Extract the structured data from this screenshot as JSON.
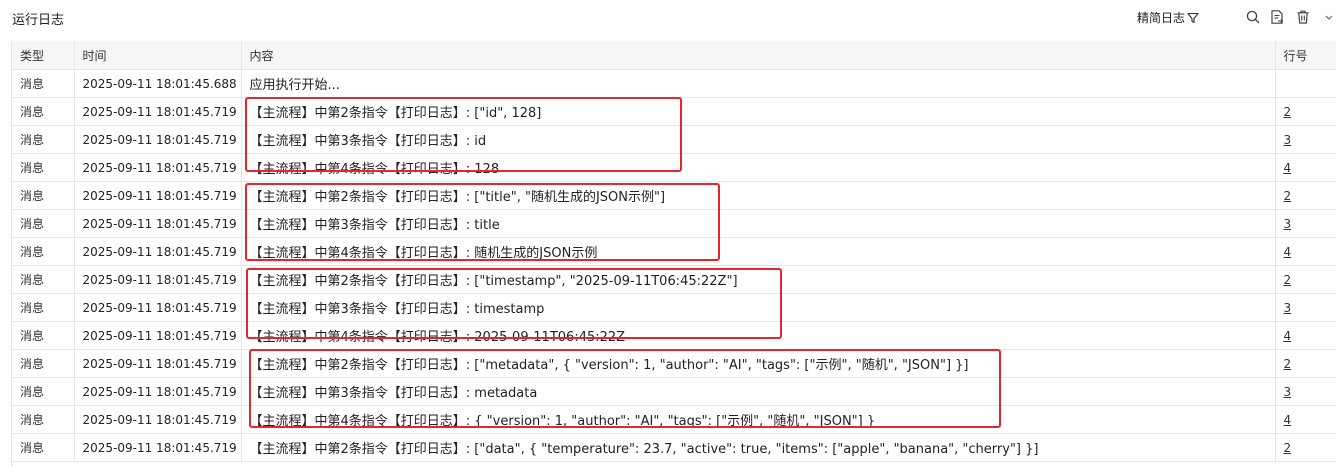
{
  "header": {
    "title": "运行日志",
    "filter_label": "精简日志",
    "icons": [
      "filter-icon",
      "search-icon",
      "export-icon",
      "delete-icon",
      "chevron-down-icon"
    ]
  },
  "table": {
    "columns": [
      "类型",
      "时间",
      "内容",
      "行号"
    ],
    "rows": [
      {
        "type": "消息",
        "time": "2025-09-11 18:01:45.688",
        "content": "应用执行开始...",
        "line": ""
      },
      {
        "type": "消息",
        "time": "2025-09-11 18:01:45.719",
        "content": "【主流程】中第2条指令【打印日志】: [\"id\", 128]",
        "line": "2"
      },
      {
        "type": "消息",
        "time": "2025-09-11 18:01:45.719",
        "content": "【主流程】中第3条指令【打印日志】: id",
        "line": "3"
      },
      {
        "type": "消息",
        "time": "2025-09-11 18:01:45.719",
        "content": "【主流程】中第4条指令【打印日志】: 128",
        "line": "4"
      },
      {
        "type": "消息",
        "time": "2025-09-11 18:01:45.719",
        "content": "【主流程】中第2条指令【打印日志】: [\"title\", \"随机生成的JSON示例\"]",
        "line": "2"
      },
      {
        "type": "消息",
        "time": "2025-09-11 18:01:45.719",
        "content": "【主流程】中第3条指令【打印日志】: title",
        "line": "3"
      },
      {
        "type": "消息",
        "time": "2025-09-11 18:01:45.719",
        "content": "【主流程】中第4条指令【打印日志】: 随机生成的JSON示例",
        "line": "4"
      },
      {
        "type": "消息",
        "time": "2025-09-11 18:01:45.719",
        "content": "【主流程】中第2条指令【打印日志】: [\"timestamp\", \"2025-09-11T06:45:22Z\"]",
        "line": "2"
      },
      {
        "type": "消息",
        "time": "2025-09-11 18:01:45.719",
        "content": "【主流程】中第3条指令【打印日志】: timestamp",
        "line": "3"
      },
      {
        "type": "消息",
        "time": "2025-09-11 18:01:45.719",
        "content": "【主流程】中第4条指令【打印日志】: 2025-09-11T06:45:22Z",
        "line": "4"
      },
      {
        "type": "消息",
        "time": "2025-09-11 18:01:45.719",
        "content": "【主流程】中第2条指令【打印日志】: [\"metadata\", { \"version\": 1, \"author\": \"AI\", \"tags\": [\"示例\", \"随机\", \"JSON\"] }]",
        "line": "2"
      },
      {
        "type": "消息",
        "time": "2025-09-11 18:01:45.719",
        "content": "【主流程】中第3条指令【打印日志】: metadata",
        "line": "3"
      },
      {
        "type": "消息",
        "time": "2025-09-11 18:01:45.719",
        "content": "【主流程】中第4条指令【打印日志】: { \"version\": 1, \"author\": \"AI\", \"tags\": [\"示例\", \"随机\", \"JSON\"] }",
        "line": "4"
      },
      {
        "type": "消息",
        "time": "2025-09-11 18:01:45.719",
        "content": "【主流程】中第2条指令【打印日志】: [\"data\", { \"temperature\": 23.7, \"active\": true, \"items\": [\"apple\", \"banana\", \"cherry\"] }]",
        "line": "2"
      }
    ]
  },
  "colors": {
    "highlight": "#e5262b",
    "header_bg": "#f5f6f8",
    "border": "#e6e6e6"
  }
}
